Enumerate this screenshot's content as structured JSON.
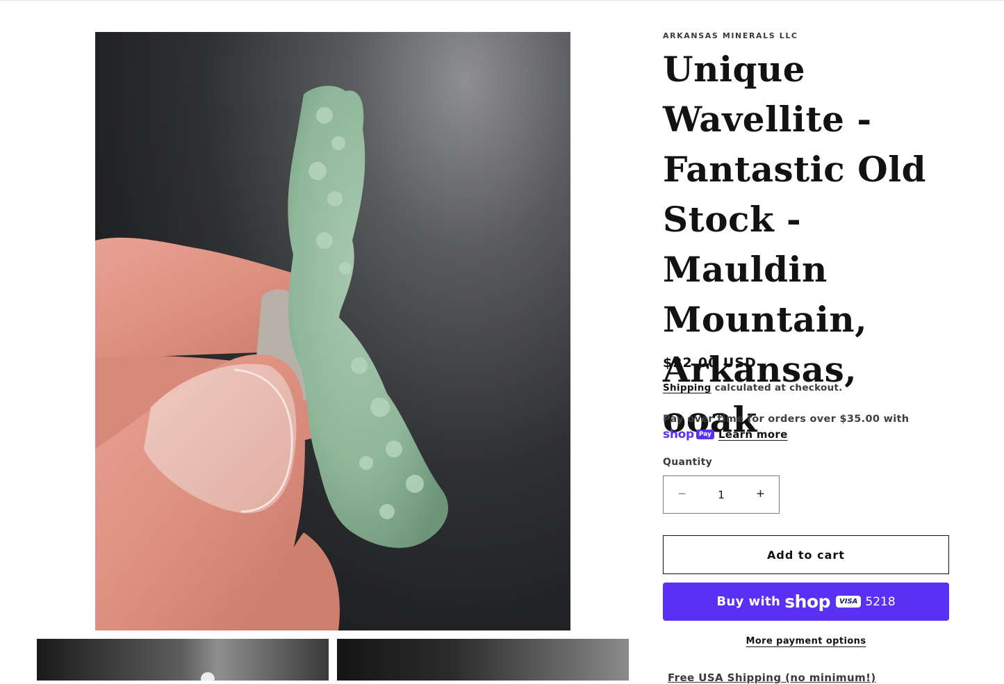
{
  "vendor": "ARKANSAS MINERALS LLC",
  "product": {
    "title": "Unique Wavellite - Fantastic Old Stock - Mauldin Mountain, Arkansas, ooak",
    "price": "$22.00 USD"
  },
  "shipping": {
    "link_label": "Shipping",
    "rest": " calculated at checkout."
  },
  "installments": {
    "text": "Pay over time for orders over $35.00 with",
    "shop_word": "shop",
    "pay_badge": "Pay",
    "learn_more": "Learn more"
  },
  "quantity": {
    "label": "Quantity",
    "value": "1",
    "minus": "−",
    "plus": "+"
  },
  "buttons": {
    "add_to_cart": "Add to cart",
    "buy_with": "Buy with",
    "buy_shop_word": "shop",
    "card_brand": "VISA",
    "card_last4": "5218",
    "more_payment": "More payment options"
  },
  "below": {
    "free_shipping": "Free USA Shipping (no minimum!)"
  },
  "colors": {
    "shop_pay": "#5a31f4",
    "text": "#121212"
  }
}
